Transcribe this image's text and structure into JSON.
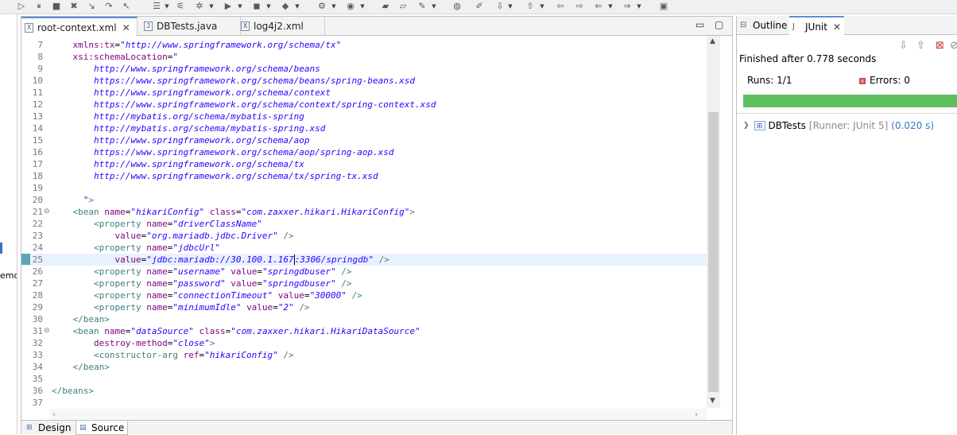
{
  "editor": {
    "tabs": [
      {
        "label": "root-context.xml",
        "icon": "xml-file-icon",
        "active": true,
        "closable": true
      },
      {
        "label": "DBTests.java",
        "icon": "java-file-icon",
        "active": false,
        "closable": false
      },
      {
        "label": "log4j2.xml",
        "icon": "xml-file-icon",
        "active": false,
        "closable": false
      }
    ],
    "current_line": 25,
    "lines": [
      {
        "n": "7",
        "fold": "",
        "parts": [
          [
            "txt",
            "    "
          ],
          [
            "att",
            "xmlns:tx"
          ],
          [
            "txt",
            "="
          ],
          [
            "val",
            "\"http://www.springframework.org/schema/tx\""
          ]
        ]
      },
      {
        "n": "8",
        "fold": "",
        "parts": [
          [
            "txt",
            "    "
          ],
          [
            "att",
            "xsi:schemaLocation"
          ],
          [
            "txt",
            "="
          ],
          [
            "val",
            "\""
          ]
        ]
      },
      {
        "n": "9",
        "fold": "",
        "parts": [
          [
            "val",
            "        http://www.springframework.org/schema/beans"
          ]
        ]
      },
      {
        "n": "10",
        "fold": "",
        "parts": [
          [
            "val",
            "        https://www.springframework.org/schema/beans/spring-beans.xsd"
          ]
        ]
      },
      {
        "n": "11",
        "fold": "",
        "parts": [
          [
            "val",
            "        http://www.springframework.org/schema/context"
          ]
        ]
      },
      {
        "n": "12",
        "fold": "",
        "parts": [
          [
            "val",
            "        https://www.springframework.org/schema/context/spring-context.xsd"
          ]
        ]
      },
      {
        "n": "13",
        "fold": "",
        "parts": [
          [
            "val",
            "        http://mybatis.org/schema/mybatis-spring"
          ]
        ]
      },
      {
        "n": "14",
        "fold": "",
        "parts": [
          [
            "val",
            "        http://mybatis.org/schema/mybatis-spring.xsd"
          ]
        ]
      },
      {
        "n": "15",
        "fold": "",
        "parts": [
          [
            "val",
            "        http://www.springframework.org/schema/aop"
          ]
        ]
      },
      {
        "n": "16",
        "fold": "",
        "parts": [
          [
            "val",
            "        https://www.springframework.org/schema/aop/spring-aop.xsd"
          ]
        ]
      },
      {
        "n": "17",
        "fold": "",
        "parts": [
          [
            "val",
            "        http://www.springframework.org/schema/tx"
          ]
        ]
      },
      {
        "n": "18",
        "fold": "",
        "parts": [
          [
            "val",
            "        http://www.springframework.org/schema/tx/spring-tx.xsd"
          ]
        ]
      },
      {
        "n": "19",
        "fold": "",
        "parts": []
      },
      {
        "n": "20",
        "fold": "",
        "parts": [
          [
            "val",
            "      \""
          ],
          [
            "tag",
            ">"
          ]
        ]
      },
      {
        "n": "21",
        "fold": "⊖",
        "parts": [
          [
            "txt",
            "    "
          ],
          [
            "tag",
            "<bean "
          ],
          [
            "att",
            "name"
          ],
          [
            "txt",
            "="
          ],
          [
            "val",
            "\"hikariConfig\""
          ],
          [
            "txt",
            " "
          ],
          [
            "att",
            "class"
          ],
          [
            "txt",
            "="
          ],
          [
            "val",
            "\"com.zaxxer.hikari.HikariConfig\""
          ],
          [
            "tag",
            ">"
          ]
        ]
      },
      {
        "n": "22",
        "fold": "",
        "parts": [
          [
            "txt",
            "        "
          ],
          [
            "tag",
            "<property "
          ],
          [
            "att",
            "name"
          ],
          [
            "txt",
            "="
          ],
          [
            "val",
            "\"driverClassName\""
          ]
        ]
      },
      {
        "n": "23",
        "fold": "",
        "parts": [
          [
            "txt",
            "            "
          ],
          [
            "att",
            "value"
          ],
          [
            "txt",
            "="
          ],
          [
            "val",
            "\"org.mariadb.jdbc.Driver\""
          ],
          [
            "txt",
            " "
          ],
          [
            "tag",
            "/>"
          ]
        ]
      },
      {
        "n": "24",
        "fold": "",
        "parts": [
          [
            "txt",
            "        "
          ],
          [
            "tag",
            "<property "
          ],
          [
            "att",
            "name"
          ],
          [
            "txt",
            "="
          ],
          [
            "val",
            "\"jdbcUrl\""
          ]
        ]
      },
      {
        "n": "25",
        "fold": "",
        "parts": [
          [
            "txt",
            "            "
          ],
          [
            "att",
            "value"
          ],
          [
            "txt",
            "="
          ],
          [
            "val",
            "\"jdbc:mariadb://30.100.1.167"
          ],
          [
            "caret",
            ""
          ],
          [
            "val",
            ":3306/springdb\""
          ],
          [
            "txt",
            " "
          ],
          [
            "tag",
            "/>"
          ]
        ]
      },
      {
        "n": "26",
        "fold": "",
        "parts": [
          [
            "txt",
            "        "
          ],
          [
            "tag",
            "<property "
          ],
          [
            "att",
            "name"
          ],
          [
            "txt",
            "="
          ],
          [
            "val",
            "\"username\""
          ],
          [
            "txt",
            " "
          ],
          [
            "att",
            "value"
          ],
          [
            "txt",
            "="
          ],
          [
            "val",
            "\"springdbuser\""
          ],
          [
            "txt",
            " "
          ],
          [
            "tag",
            "/>"
          ]
        ]
      },
      {
        "n": "27",
        "fold": "",
        "parts": [
          [
            "txt",
            "        "
          ],
          [
            "tag",
            "<property "
          ],
          [
            "att",
            "name"
          ],
          [
            "txt",
            "="
          ],
          [
            "val",
            "\"password\""
          ],
          [
            "txt",
            " "
          ],
          [
            "att",
            "value"
          ],
          [
            "txt",
            "="
          ],
          [
            "val",
            "\"springdbuser\""
          ],
          [
            "txt",
            " "
          ],
          [
            "tag",
            "/>"
          ]
        ]
      },
      {
        "n": "28",
        "fold": "",
        "parts": [
          [
            "txt",
            "        "
          ],
          [
            "tag",
            "<property "
          ],
          [
            "att",
            "name"
          ],
          [
            "txt",
            "="
          ],
          [
            "val",
            "\"connectionTimeout\""
          ],
          [
            "txt",
            " "
          ],
          [
            "att",
            "value"
          ],
          [
            "txt",
            "="
          ],
          [
            "val",
            "\"30000\""
          ],
          [
            "txt",
            " "
          ],
          [
            "tag",
            "/>"
          ]
        ]
      },
      {
        "n": "29",
        "fold": "",
        "parts": [
          [
            "txt",
            "        "
          ],
          [
            "tag",
            "<property "
          ],
          [
            "att",
            "name"
          ],
          [
            "txt",
            "="
          ],
          [
            "val",
            "\"minimumIdle\""
          ],
          [
            "txt",
            " "
          ],
          [
            "att",
            "value"
          ],
          [
            "txt",
            "="
          ],
          [
            "val",
            "\"2\""
          ],
          [
            "txt",
            " "
          ],
          [
            "tag",
            "/>"
          ]
        ]
      },
      {
        "n": "30",
        "fold": "",
        "parts": [
          [
            "txt",
            "    "
          ],
          [
            "tag",
            "</bean>"
          ]
        ]
      },
      {
        "n": "31",
        "fold": "⊖",
        "parts": [
          [
            "txt",
            "    "
          ],
          [
            "tag",
            "<bean "
          ],
          [
            "att",
            "name"
          ],
          [
            "txt",
            "="
          ],
          [
            "val",
            "\"dataSource\""
          ],
          [
            "txt",
            " "
          ],
          [
            "att",
            "class"
          ],
          [
            "txt",
            "="
          ],
          [
            "val",
            "\"com.zaxxer.hikari.HikariDataSource\""
          ]
        ]
      },
      {
        "n": "32",
        "fold": "",
        "parts": [
          [
            "txt",
            "        "
          ],
          [
            "att",
            "destroy-method"
          ],
          [
            "txt",
            "="
          ],
          [
            "val",
            "\"close\""
          ],
          [
            "tag",
            ">"
          ]
        ]
      },
      {
        "n": "33",
        "fold": "",
        "parts": [
          [
            "txt",
            "        "
          ],
          [
            "tag",
            "<constructor-arg "
          ],
          [
            "att",
            "ref"
          ],
          [
            "txt",
            "="
          ],
          [
            "val",
            "\"hikariConfig\""
          ],
          [
            "txt",
            " "
          ],
          [
            "tag",
            "/>"
          ]
        ]
      },
      {
        "n": "34",
        "fold": "",
        "parts": [
          [
            "txt",
            "    "
          ],
          [
            "tag",
            "</bean>"
          ]
        ]
      },
      {
        "n": "35",
        "fold": "",
        "parts": []
      },
      {
        "n": "36",
        "fold": "",
        "parts": [
          [
            "tag",
            "</beans>"
          ]
        ]
      },
      {
        "n": "37",
        "fold": "",
        "parts": []
      }
    ],
    "bottom_tabs": [
      {
        "label": "Design",
        "icon": "design-icon",
        "active": false
      },
      {
        "label": "Source",
        "icon": "source-icon",
        "active": true
      }
    ]
  },
  "left_strip": {
    "cut_text": "emo"
  },
  "junit": {
    "tabs": [
      {
        "label": "Outline",
        "icon": "outline-icon",
        "active": false
      },
      {
        "label": "JUnit",
        "icon": "junit-icon",
        "active": true
      }
    ],
    "finished": "Finished after 0.778 seconds",
    "runs_label": "Runs:",
    "runs_value": "1/1",
    "errors_label": "Errors:",
    "errors_value": "0",
    "progress": 1.0,
    "progress_color": "#5fbf5f",
    "tree": {
      "name": "DBTests",
      "runner": "[Runner: JUnit 5]",
      "time": "(0.020 s)"
    }
  },
  "colors": {
    "tag": "#3f7f7f",
    "attribute": "#7f007f",
    "value": "#2a00ff",
    "current_line": "#e8f2fe"
  }
}
